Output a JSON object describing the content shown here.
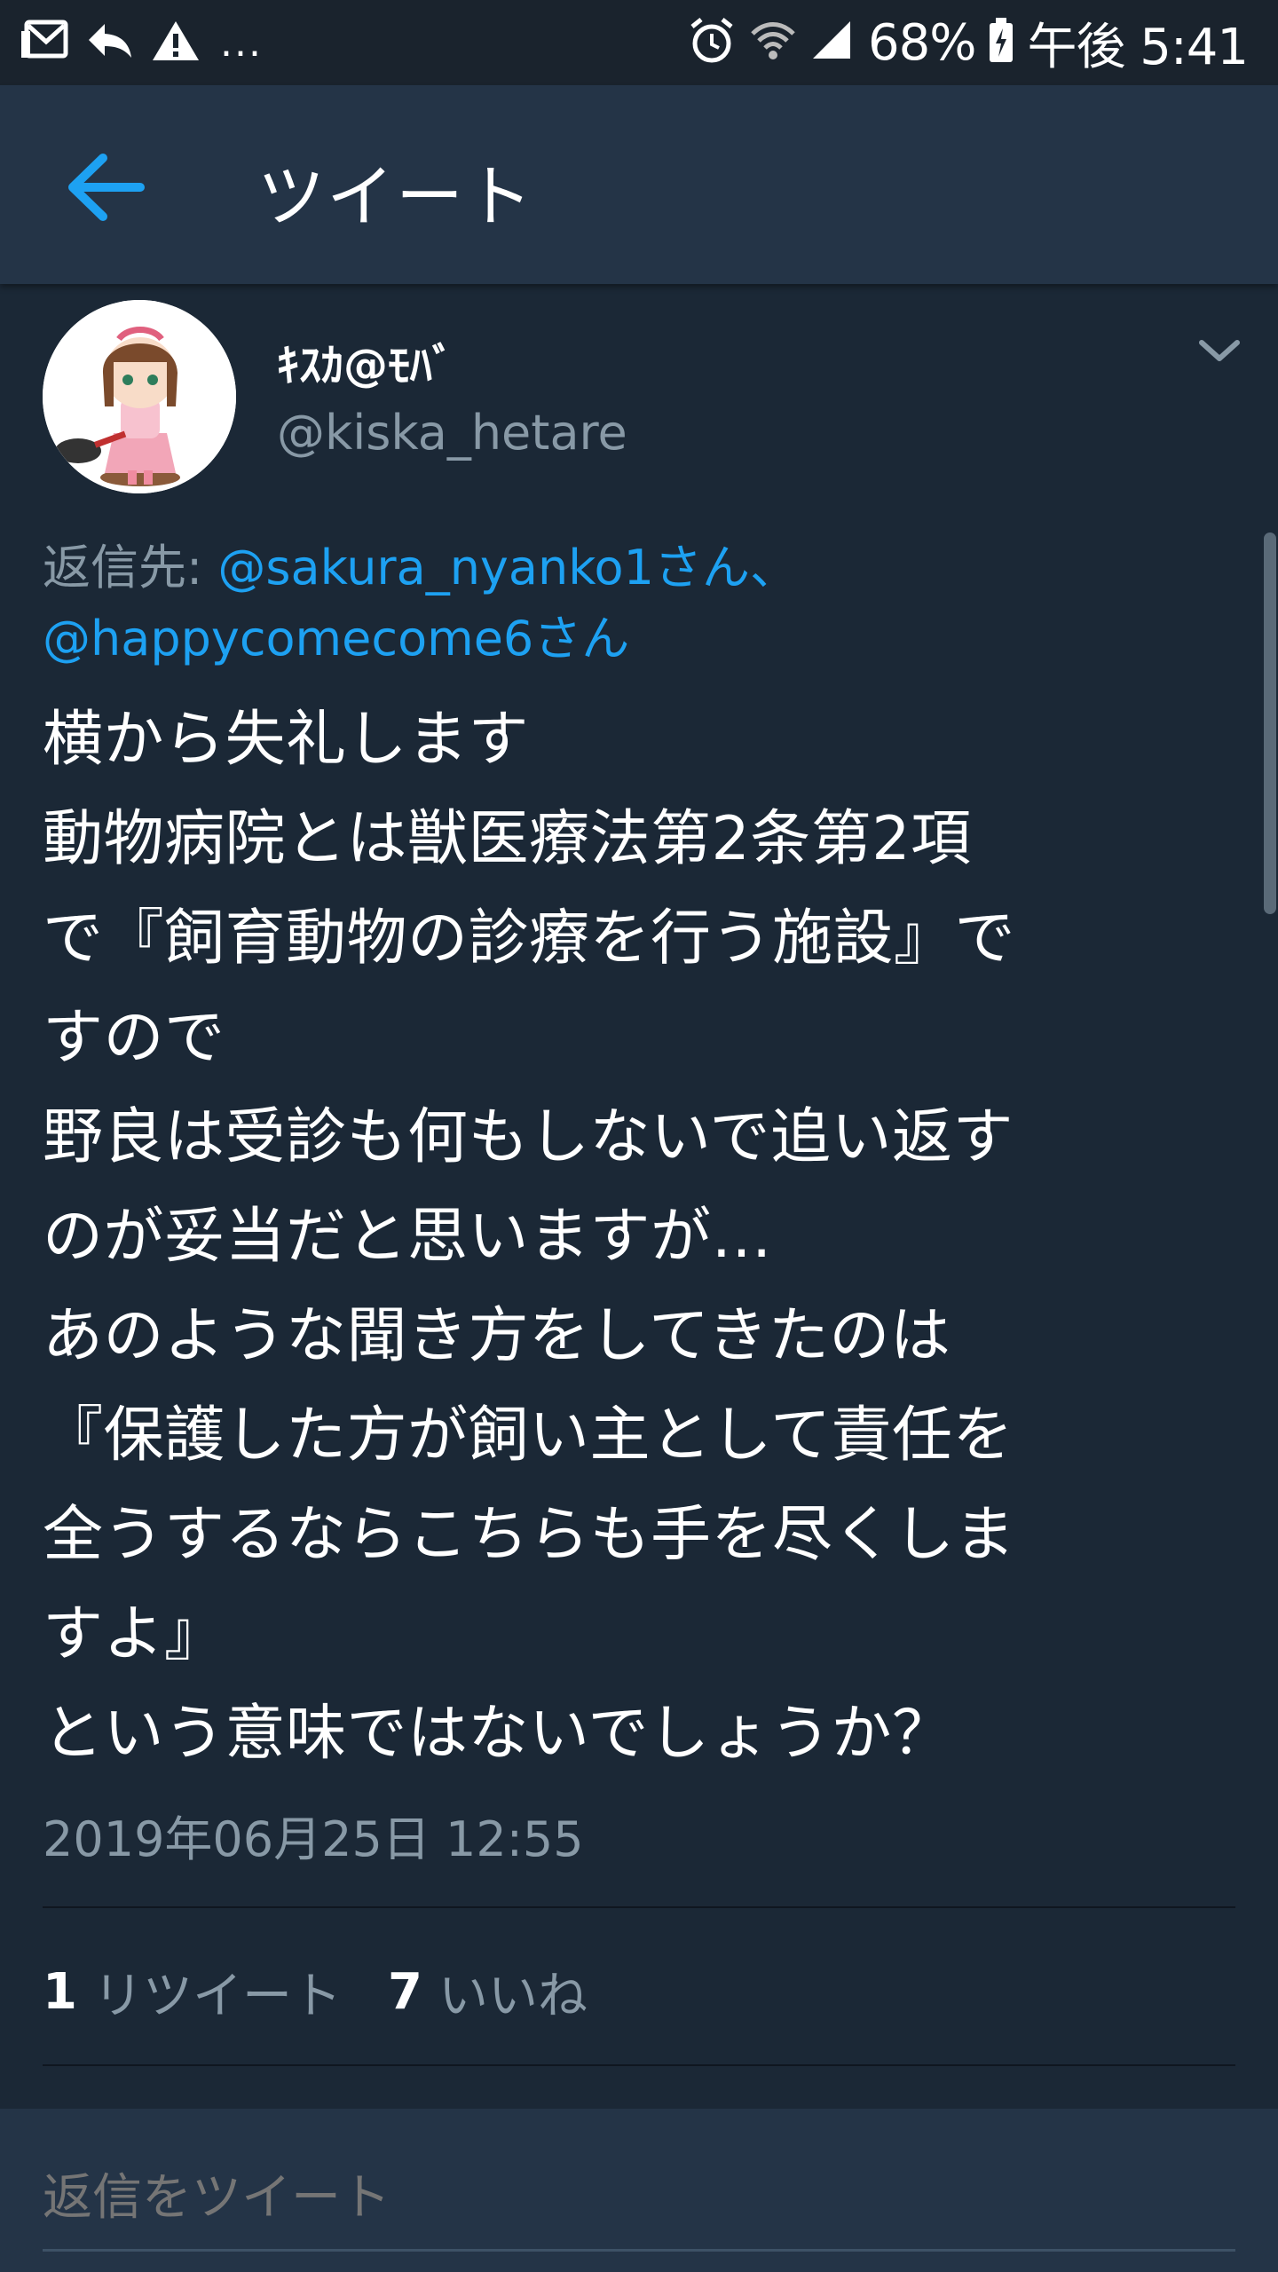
{
  "status_bar": {
    "battery": "68%",
    "time": "午後 5:41",
    "ellipsis": "...",
    "icons": [
      "mail-icon",
      "reply-icon",
      "warning-icon",
      "alarm-icon",
      "wifi-icon",
      "signal-icon",
      "battery-icon"
    ]
  },
  "header": {
    "title": "ツイート",
    "back_icon": "arrow-left-icon"
  },
  "tweet": {
    "display_name": "ｷｽｶ@ﾓﾊﾞ",
    "handle": "@kiska_hetare",
    "reply_prefix": "返信先: ",
    "mention_1": "@sakura_nyanko1さん、",
    "mention_2": "@happycomecome6さん",
    "body": "横から失礼します\n動物病院とは獣医療法第2条第2項\nで『飼育動物の診療を行う施設』で\nすので\n野良は受診も何もしないで追い返す\nのが妥当だと思いますが…\nあのような聞き方をしてきたのは\n『保護した方が飼い主として責任を\n全うするならこちらも手を尽くしま\nすよ』\nという意味ではないでしょうか？",
    "timestamp": "2019年06月25日 12:55"
  },
  "stats": {
    "retweet_count": "1",
    "retweet_label": "リツイート",
    "like_count": "7",
    "like_label": "いいね"
  },
  "reply_bar": {
    "placeholder": "返信をツイート"
  },
  "colors": {
    "background": "#1b2836",
    "header": "#243447",
    "accent": "#1da1f2",
    "secondary_text": "#8899a6"
  }
}
